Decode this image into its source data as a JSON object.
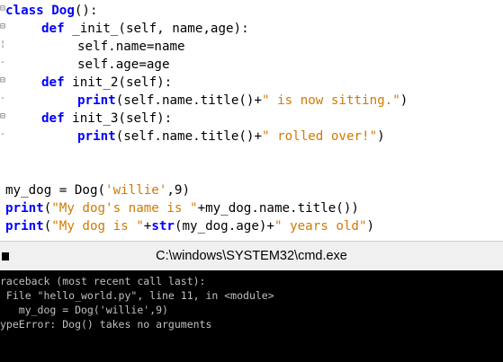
{
  "editor": {
    "lines": [
      [
        "class Dog",
        "():"
      ],
      [
        "def",
        " _init_(self, name,age):"
      ],
      [
        "self.name=name"
      ],
      [
        "self.age=age"
      ],
      [
        "def",
        " init_2(self):"
      ],
      [
        "print",
        "(self.name.title()+",
        "\" is now sitting.\"",
        ")"
      ],
      [
        "def",
        " init_3(self):"
      ],
      [
        "print",
        "(self.name.title()+",
        "\" rolled over!\"",
        ")"
      ],
      [
        "my_dog = Dog(",
        "'willie'",
        ",9)"
      ],
      [
        "print",
        "(",
        "\"My dog's name is \"",
        "+my_dog.name.title())"
      ],
      [
        "print",
        "(",
        "\"My dog is \"",
        "+",
        "str",
        "(my_dog.age)+",
        "\" years old\"",
        ")"
      ]
    ]
  },
  "window": {
    "title": "C:\\windows\\SYSTEM32\\cmd.exe"
  },
  "console": {
    "lines": [
      "raceback (most recent call last):",
      " File \"hello_world.py\", line 11, in <module>",
      "   my_dog = Dog('willie',9)",
      "ypeError: Dog() takes no arguments"
    ]
  },
  "colors": {
    "keyword": "#0000ff",
    "string": "#d27a00",
    "console_bg": "#000000",
    "console_text": "#c0c0c0"
  }
}
